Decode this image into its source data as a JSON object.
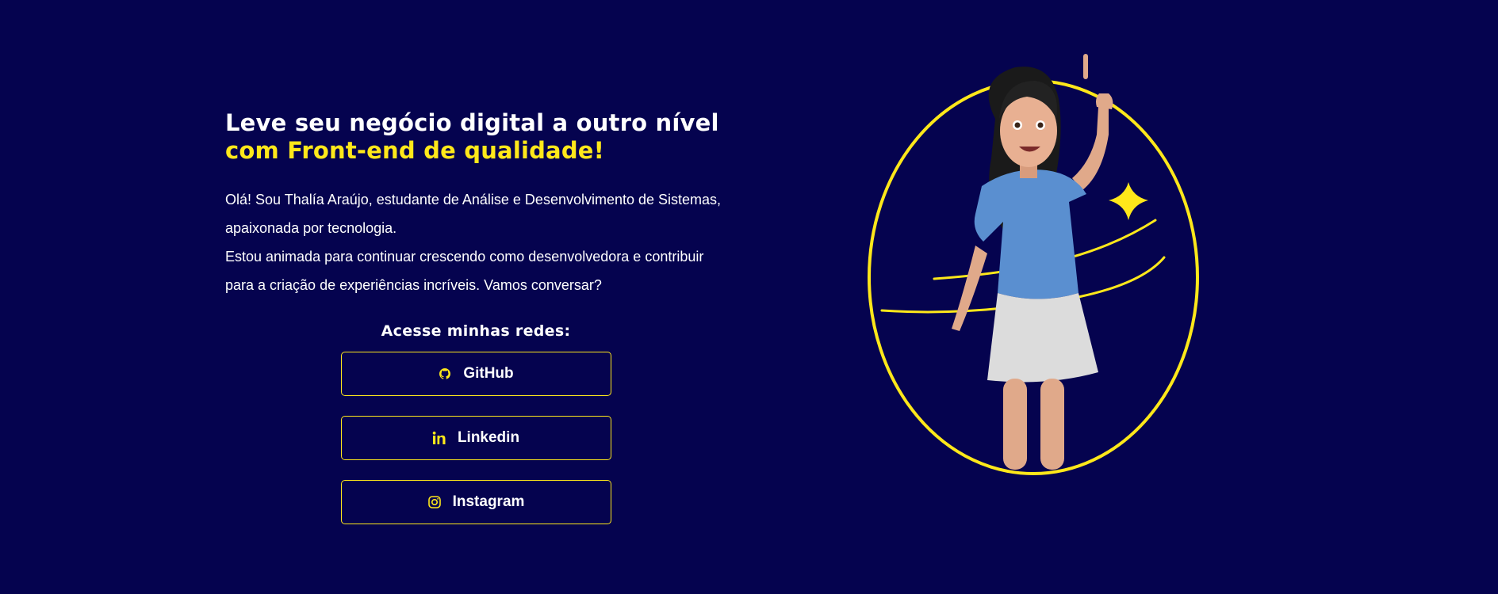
{
  "hero": {
    "headline_part1": "Leve seu negócio digital a outro nível ",
    "headline_highlight": "com Front-end de qualidade!",
    "intro_line1": "Olá! Sou Thalía Araújo, estudante de Análise e Desenvolvimento de Sistemas, apaixonada por tecnologia.",
    "intro_line2": "Estou animada para continuar crescendo como desenvolvedora e contribuir para a criação de experiências incríveis. Vamos conversar?"
  },
  "socials": {
    "title": "Acesse minhas redes:",
    "buttons": [
      {
        "label": "GitHub",
        "icon": "github-icon"
      },
      {
        "label": "Linkedin",
        "icon": "linkedin-icon"
      },
      {
        "label": "Instagram",
        "icon": "instagram-icon"
      }
    ]
  },
  "colors": {
    "background": "#05034f",
    "accent": "#ffe81a",
    "text": "#ffffff"
  },
  "illustration": {
    "icon": "avatar-girl-illustration"
  }
}
